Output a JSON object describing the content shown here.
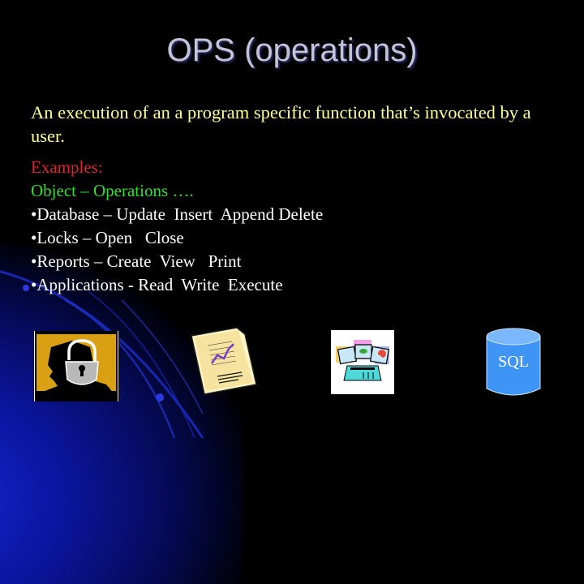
{
  "slide": {
    "title": "OPS (operations)",
    "intro": "An execution of an a program specific function that’s invocated by a user.",
    "examples_label": "Examples:",
    "object_operations": "Object – Operations ….",
    "bullets": [
      "•Database – Update  Insert  Append Delete",
      "•Locks – Open   Close",
      "•Reports – Create  View   Print",
      "•Applications - Read  Write  Execute"
    ],
    "images": [
      {
        "icon": "lock-head-icon",
        "meaning": "Locks"
      },
      {
        "icon": "report-document-icon",
        "meaning": "Reports"
      },
      {
        "icon": "applications-monitors-icon",
        "meaning": "Applications"
      },
      {
        "icon": "database-cylinder-icon",
        "label": "SQL",
        "meaning": "Database"
      }
    ],
    "colors": {
      "background": "#000000",
      "title": "#c3c4d8",
      "intro": "#ffff99",
      "examples_label": "#e2242c",
      "object_operations": "#33dd33",
      "bullets": "#ffffff",
      "sql_cylinder": "#3f95f5"
    }
  }
}
